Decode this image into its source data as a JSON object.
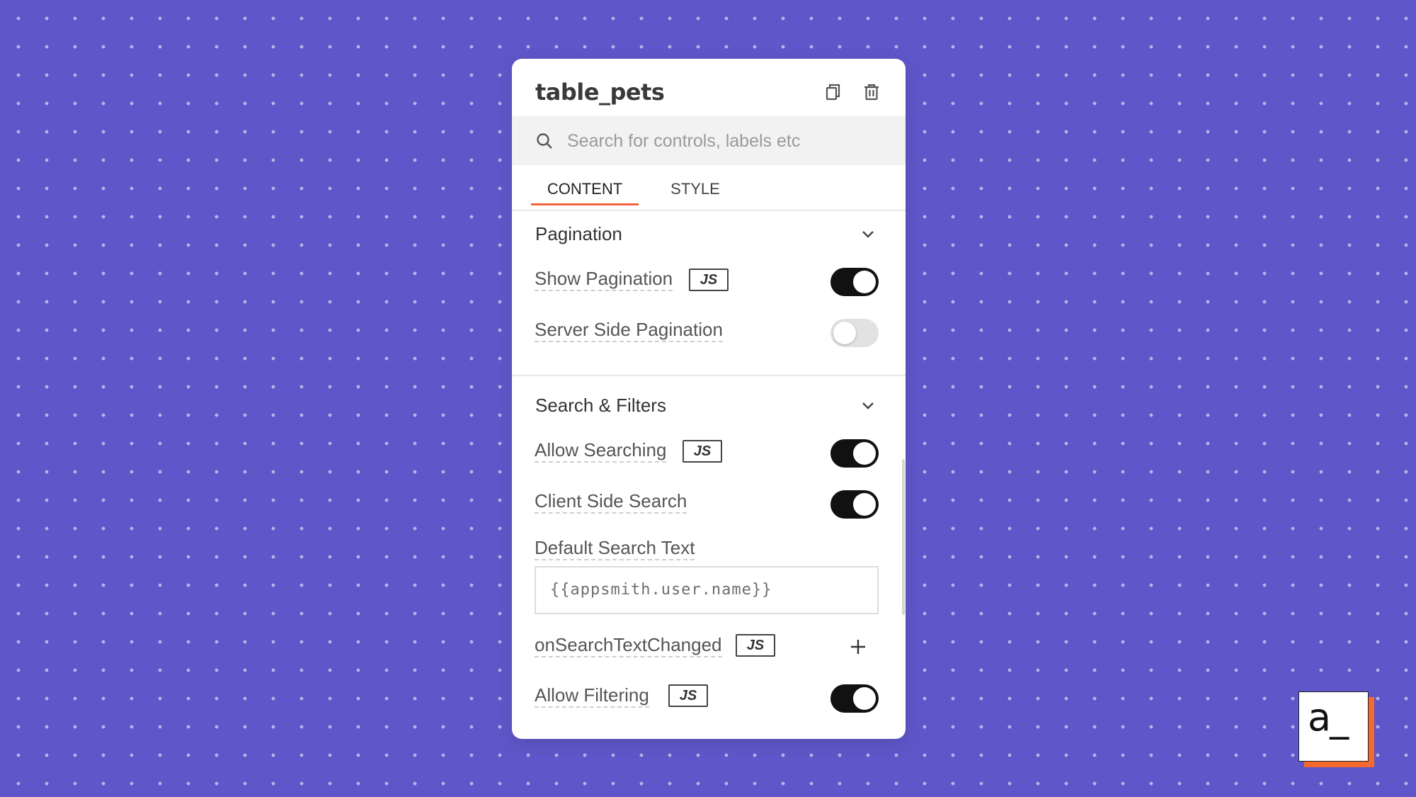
{
  "panel": {
    "title": "table_pets",
    "header_icons": [
      "copy-icon",
      "trash-icon"
    ]
  },
  "search": {
    "placeholder": "Search for controls, labels etc",
    "value": ""
  },
  "tabs": [
    {
      "label": "CONTENT",
      "active": true
    },
    {
      "label": "STYLE",
      "active": false
    }
  ],
  "pagination": {
    "title": "Pagination",
    "show_pagination": {
      "label": "Show Pagination",
      "badge": "JS",
      "on": true
    },
    "server_side": {
      "label": "Server Side Pagination",
      "on": false
    }
  },
  "search_filters": {
    "title": "Search & Filters",
    "allow_searching": {
      "label": "Allow Searching",
      "badge": "JS",
      "on": true
    },
    "client_side_search": {
      "label": "Client Side Search",
      "on": true
    },
    "default_search_text": {
      "label": "Default Search Text",
      "value": "{{appsmith.user.name}}"
    },
    "on_search_text_changed": {
      "label": "onSearchTextChanged",
      "badge": "JS"
    },
    "allow_filtering": {
      "label": "Allow Filtering",
      "badge": "JS",
      "on": true
    }
  },
  "colors": {
    "background": "#5f57c9",
    "accent": "#f2643d",
    "toggle_on": "#111111",
    "toggle_off": "#e2e2e2"
  },
  "logo": {
    "text": "a_"
  }
}
